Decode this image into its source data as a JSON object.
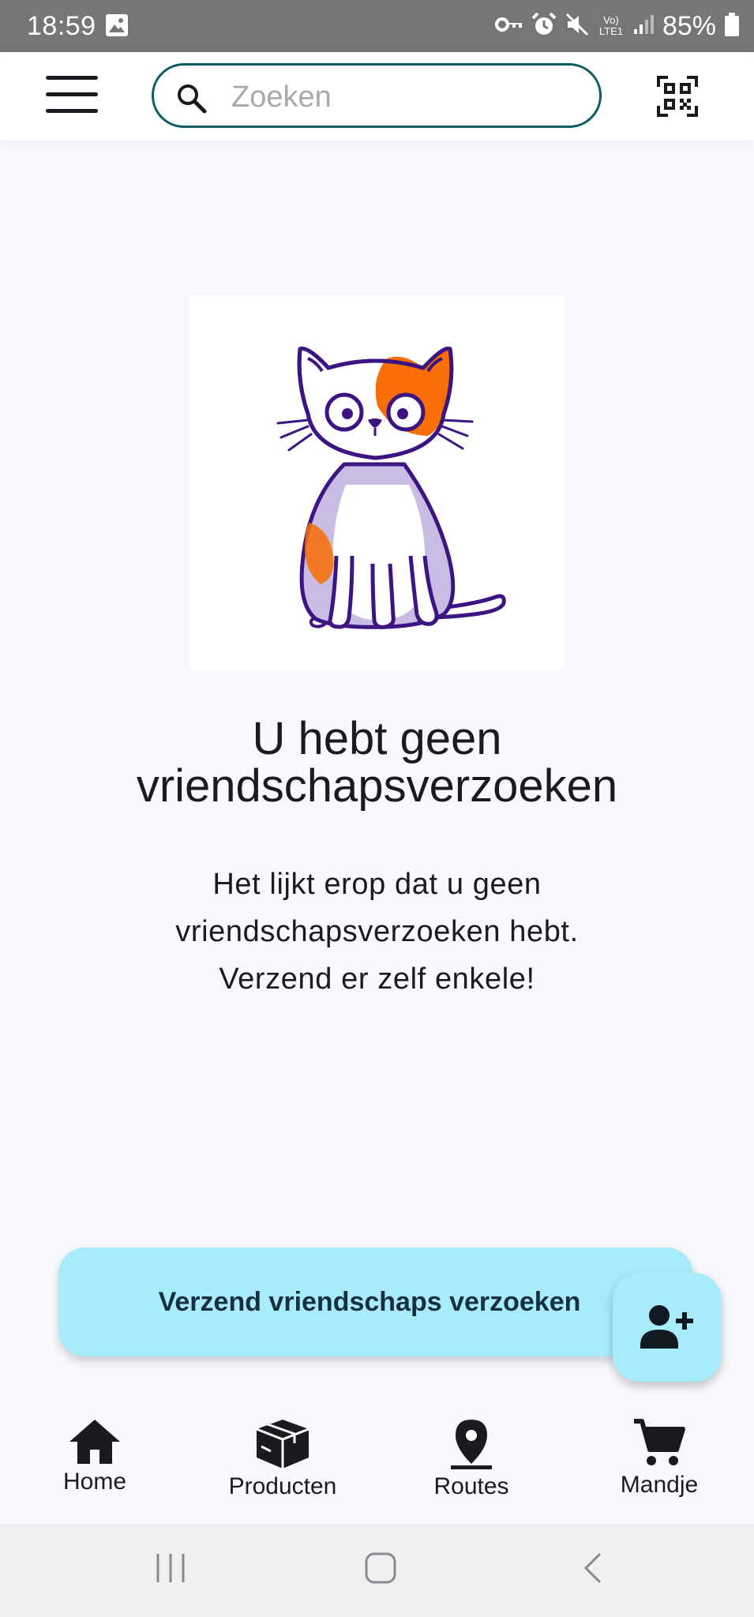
{
  "status_bar": {
    "time": "18:59",
    "battery": "85%",
    "network_label": "Vo) LTE1"
  },
  "app_bar": {
    "search_placeholder": "Zoeken"
  },
  "empty_state": {
    "title_line1": "U hebt geen",
    "title_line2": "vriendschapsverzoeken",
    "subtitle_line1": "Het lijkt erop dat u geen",
    "subtitle_line2": "vriendschapsverzoeken hebt.",
    "subtitle_line3": "Verzend er zelf enkele!"
  },
  "actions": {
    "send_requests_label": "Verzend vriendschaps verzoeken",
    "fab_icon": "person-add-icon"
  },
  "bottom_nav": {
    "items": [
      {
        "label": "Home",
        "icon": "home-icon"
      },
      {
        "label": "Producten",
        "icon": "package-icon"
      },
      {
        "label": "Routes",
        "icon": "location-pin-icon"
      },
      {
        "label": "Mandje",
        "icon": "cart-icon"
      }
    ]
  },
  "colors": {
    "accent_container": "#a8ebfb",
    "search_border": "#0b5c66",
    "cat_outline": "#3c1582",
    "cat_patch": "#f96d05",
    "cat_belly": "#c9bce4"
  }
}
